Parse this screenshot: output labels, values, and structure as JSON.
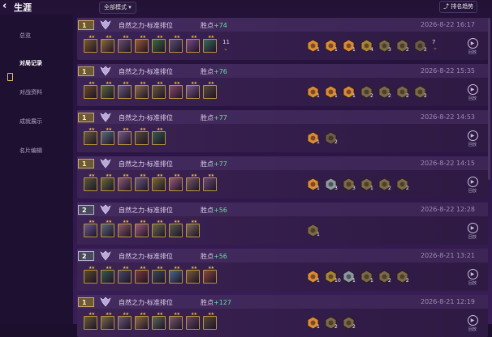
{
  "header": {
    "back_icon": "chevron-left-icon",
    "title": "生涯",
    "mode_filter": "全部模式",
    "trend_label": "排名趋势",
    "trend_icon": "trend-chart-icon"
  },
  "sidebar": {
    "items": [
      {
        "label": "总览"
      },
      {
        "label": "对局记录",
        "active": true
      },
      {
        "label": "对战资料"
      },
      {
        "label": "成就展示"
      },
      {
        "label": "名片编辑"
      }
    ]
  },
  "colors": {
    "accent_gold": "#c9a964",
    "score_green": "#5fe0a0",
    "background": "#2a1545"
  },
  "matches": [
    {
      "rank": "1",
      "mode": "自然之力-标准排位",
      "score_label": "胜点",
      "score_value": "+74",
      "date": "2026-8-22  16:17",
      "champ_colors": [
        "#7a5a2e",
        "#8a6a3a",
        "#6a5070",
        "#9a5a30",
        "#3a6a40",
        "#5a5070",
        "#7a4a8a",
        "#3a6a5a"
      ],
      "extra_units": "11",
      "traits": [
        {
          "c": "#d98a3a",
          "n": "1"
        },
        {
          "c": "#d98a3a",
          "n": "1"
        },
        {
          "c": "#d98a3a",
          "n": "1"
        },
        {
          "c": "#a8843a",
          "n": "4"
        },
        {
          "c": "#7a6a4a",
          "n": "3"
        },
        {
          "c": "#7a6a4a",
          "n": "2"
        },
        {
          "c": "#6a5a4a",
          "n": "2"
        }
      ],
      "extra_traits": "7",
      "replay": "回放"
    },
    {
      "rank": "1",
      "mode": "自然之力-标准排位",
      "score_label": "胜点",
      "score_value": "+76",
      "date": "2026-8-22  15:35",
      "champ_colors": [
        "#6a4a2a",
        "#5a6a3a",
        "#6a5a7a",
        "#8a6a4a",
        "#6a5a3a",
        "#8a4a6a",
        "#7a5a8a",
        "#5a4a3a"
      ],
      "extra_units": "",
      "traits": [
        {
          "c": "#d98a3a",
          "n": "1"
        },
        {
          "c": "#d98a3a",
          "n": "1"
        },
        {
          "c": "#d98a3a",
          "n": "1"
        },
        {
          "c": "#7a6a4a",
          "n": "2"
        },
        {
          "c": "#7a6a4a",
          "n": "2"
        },
        {
          "c": "#7a6a4a",
          "n": "2"
        },
        {
          "c": "#7a6a4a",
          "n": "2"
        }
      ],
      "extra_traits": "",
      "replay": "回放"
    },
    {
      "rank": "1",
      "mode": "自然之力-标准排位",
      "score_label": "胜点",
      "score_value": "+77",
      "date": "2026-8-22  14:53",
      "champ_colors": [
        "#6a5a3a",
        "#5a6a7a",
        "#7a5a8a",
        "#5a4a3a",
        "#3a5a4a"
      ],
      "extra_units": "",
      "traits": [
        {
          "c": "#d98a3a",
          "n": "1"
        },
        {
          "c": "#6a5a4a",
          "n": "2"
        }
      ],
      "extra_traits": "",
      "replay": "回放"
    },
    {
      "rank": "1",
      "mode": "自然之力-标准排位",
      "score_label": "胜点",
      "score_value": "+77",
      "date": "2026-8-22  14:15",
      "champ_colors": [
        "#5a5a3a",
        "#6a6a3a",
        "#8a5a7a",
        "#6a5a7a",
        "#7a6a3a",
        "#9a5a7a",
        "#7a5a6a",
        "#6a4a7a"
      ],
      "extra_units": "",
      "traits": [
        {
          "c": "#d98a3a",
          "n": "1"
        },
        {
          "c": "#8a9aa8",
          "n": "3"
        },
        {
          "c": "#7a6a4a",
          "n": "3"
        },
        {
          "c": "#7a6a4a",
          "n": "1"
        },
        {
          "c": "#7a6a4a",
          "n": "2"
        },
        {
          "c": "#7a6a4a",
          "n": "2"
        }
      ],
      "extra_traits": "",
      "replay": "回放"
    },
    {
      "rank": "2",
      "mode": "自然之力-标准排位",
      "score_label": "胜点",
      "score_value": "+56",
      "date": "2026-8-22  12:28",
      "champ_colors": [
        "#6a5a8a",
        "#5a6a7a",
        "#8a5a6a",
        "#9a5a7a",
        "#6a6a4a",
        "#5a5a4a",
        "#7a6a5a"
      ],
      "extra_units": "",
      "traits": [
        {
          "c": "#7a6a4a",
          "n": "1"
        }
      ],
      "extra_traits": "",
      "replay": "回放"
    },
    {
      "rank": "2",
      "mode": "自然之力-标准排位",
      "score_label": "胜点",
      "score_value": "+56",
      "date": "2026-8-21  13:21",
      "champ_colors": [
        "#5a4a2a",
        "#3a5a4a",
        "#4a4a6a",
        "#7a3a3a",
        "#3a4a5a",
        "#4a6a8a",
        "#7a5a3a",
        "#8a4a3a"
      ],
      "extra_units": "",
      "traits": [
        {
          "c": "#d98a3a",
          "n": "1"
        },
        {
          "c": "#a8843a",
          "n": "10"
        },
        {
          "c": "#8a9aa8",
          "n": "1"
        },
        {
          "c": "#7a6a4a",
          "n": "1"
        },
        {
          "c": "#7a6a4a",
          "n": "2"
        },
        {
          "c": "#7a6a4a",
          "n": "2"
        }
      ],
      "extra_traits": "",
      "replay": "回放"
    },
    {
      "rank": "1",
      "mode": "自然之力-标准排位",
      "score_label": "胜点",
      "score_value": "+127",
      "date": "2026-8-21  12:19",
      "champ_colors": [
        "#6a5a3a",
        "#7a6a4a",
        "#6a5a7a",
        "#8a6a4a",
        "#5a6a5a",
        "#7a5a6a",
        "#6a4a6a",
        "#5a4a3a"
      ],
      "extra_units": "",
      "traits": [
        {
          "c": "#d98a3a",
          "n": "1"
        },
        {
          "c": "#7a6a4a",
          "n": "2"
        },
        {
          "c": "#7a6a4a",
          "n": "2"
        }
      ],
      "extra_traits": "",
      "replay": "回放"
    }
  ]
}
